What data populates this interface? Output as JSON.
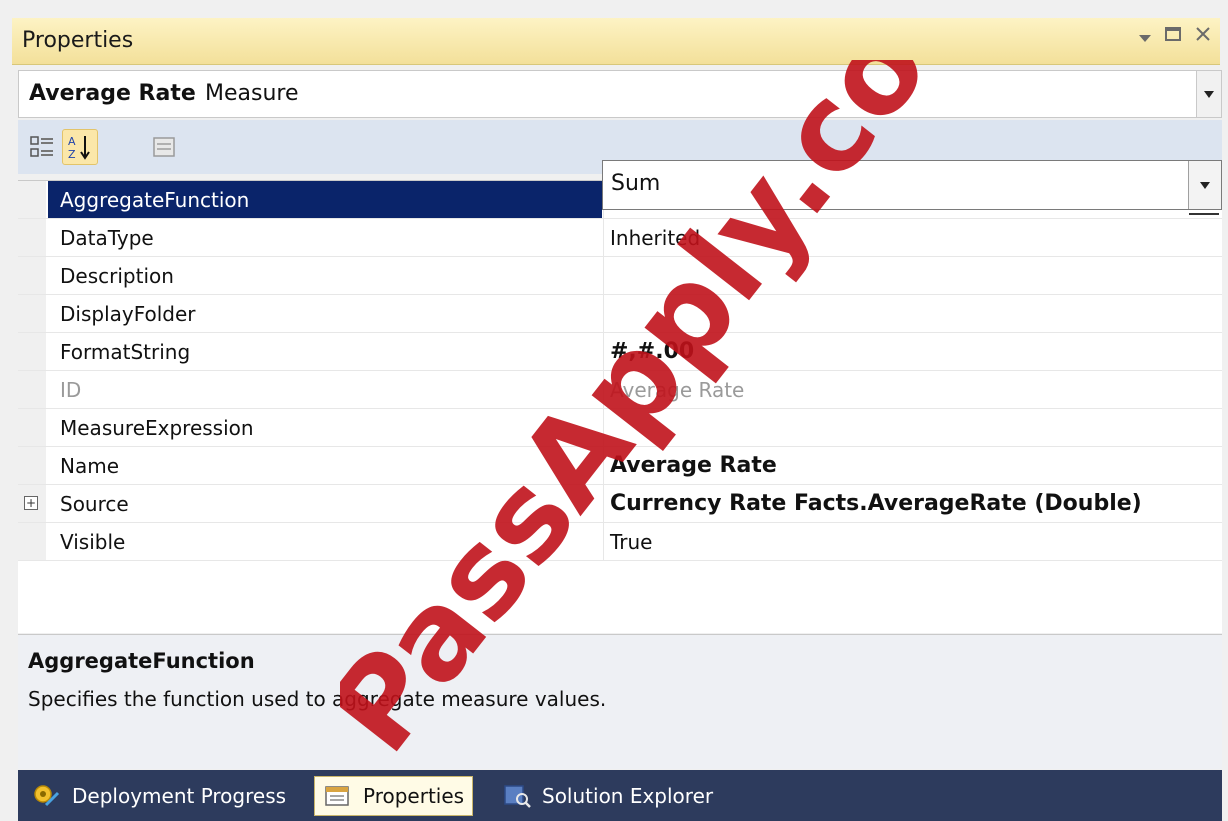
{
  "panel": {
    "title": "Properties"
  },
  "object_selector": {
    "name": "Average Rate",
    "type": "Measure"
  },
  "toolbar": {
    "buttons": [
      "categorized-icon",
      "alphabetical-icon",
      "property-pages-icon"
    ]
  },
  "properties": [
    {
      "name": "AggregateFunction",
      "value": "Sum",
      "selected": true
    },
    {
      "name": "DataType",
      "value": "Inherited"
    },
    {
      "name": "Description",
      "value": ""
    },
    {
      "name": "DisplayFolder",
      "value": ""
    },
    {
      "name": "FormatString",
      "value": "#,#.00",
      "bold": true
    },
    {
      "name": "ID",
      "value": "Average Rate",
      "readonly": true
    },
    {
      "name": "MeasureExpression",
      "value": ""
    },
    {
      "name": "Name",
      "value": "Average Rate",
      "bold": true
    },
    {
      "name": "Source",
      "value": "Currency Rate Facts.AverageRate (Double)",
      "bold": true,
      "expandable": true
    },
    {
      "name": "Visible",
      "value": "True"
    }
  ],
  "description": {
    "title": "AggregateFunction",
    "text": "Specifies the function used to aggregate measure values."
  },
  "tabs": [
    {
      "label": "Deployment Progress"
    },
    {
      "label": "Properties",
      "active": true
    },
    {
      "label": "Solution Explorer"
    }
  ],
  "watermark": "PassApply.com",
  "colors": {
    "selection": "#0a246a",
    "title_bar": "#f3e09a",
    "tab_bar": "#2d3b5d",
    "watermark": "#c0121b"
  }
}
